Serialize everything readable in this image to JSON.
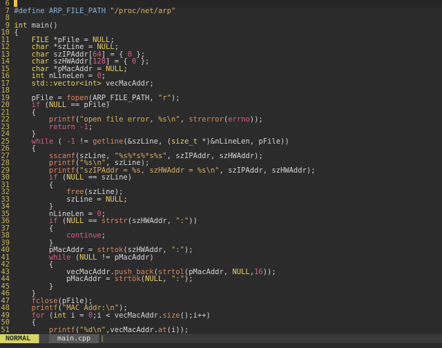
{
  "editor": {
    "lines": [
      {
        "n": "6",
        "current": true,
        "tokens": []
      },
      {
        "n": "7",
        "tokens": [
          [
            "pre",
            "#define ARP_FILE_PATH "
          ],
          [
            "str",
            "\"/proc/net/arp\""
          ]
        ]
      },
      {
        "n": "8",
        "tokens": []
      },
      {
        "n": "9",
        "tokens": [
          [
            "type",
            "int"
          ],
          [
            "plain",
            " main()"
          ]
        ]
      },
      {
        "n": "10",
        "tokens": [
          [
            "plain",
            "{"
          ]
        ]
      },
      {
        "n": "11",
        "tokens": [
          [
            "plain",
            "    "
          ],
          [
            "type",
            "FILE"
          ],
          [
            "plain",
            " *pFile = "
          ],
          [
            "type",
            "NULL"
          ],
          [
            "plain",
            ";"
          ]
        ]
      },
      {
        "n": "12",
        "tokens": [
          [
            "plain",
            "    "
          ],
          [
            "type",
            "char"
          ],
          [
            "plain",
            " *szLine = "
          ],
          [
            "type",
            "NULL"
          ],
          [
            "plain",
            ";"
          ]
        ]
      },
      {
        "n": "13",
        "tokens": [
          [
            "plain",
            "    "
          ],
          [
            "type",
            "char"
          ],
          [
            "plain",
            " szIPAddr["
          ],
          [
            "num",
            "64"
          ],
          [
            "plain",
            "] = { "
          ],
          [
            "num",
            "0"
          ],
          [
            "plain",
            " };"
          ]
        ]
      },
      {
        "n": "14",
        "tokens": [
          [
            "plain",
            "    "
          ],
          [
            "type",
            "char"
          ],
          [
            "plain",
            " szHWAddr["
          ],
          [
            "num",
            "128"
          ],
          [
            "plain",
            "] = { "
          ],
          [
            "num",
            "0"
          ],
          [
            "plain",
            " };"
          ]
        ]
      },
      {
        "n": "15",
        "tokens": [
          [
            "plain",
            "    "
          ],
          [
            "type",
            "char"
          ],
          [
            "plain",
            " *pMacAddr = "
          ],
          [
            "type",
            "NULL"
          ],
          [
            "plain",
            ";"
          ]
        ]
      },
      {
        "n": "16",
        "tokens": [
          [
            "plain",
            "    "
          ],
          [
            "type",
            "int"
          ],
          [
            "plain",
            " nLineLen = "
          ],
          [
            "num",
            "0"
          ],
          [
            "plain",
            ";"
          ]
        ]
      },
      {
        "n": "17",
        "tokens": [
          [
            "plain",
            "    "
          ],
          [
            "type",
            "std::vector<int>"
          ],
          [
            "plain",
            " vecMacAddr;"
          ]
        ]
      },
      {
        "n": "18",
        "tokens": []
      },
      {
        "n": "19",
        "tokens": [
          [
            "plain",
            "    pFile = "
          ],
          [
            "fn",
            "fopen"
          ],
          [
            "plain",
            "(ARP_FILE_PATH, "
          ],
          [
            "str",
            "\"r\""
          ],
          [
            "plain",
            ");"
          ]
        ]
      },
      {
        "n": "20",
        "tokens": [
          [
            "plain",
            "    "
          ],
          [
            "kw",
            "if"
          ],
          [
            "plain",
            " ("
          ],
          [
            "type",
            "NULL"
          ],
          [
            "plain",
            " == pFile)"
          ]
        ]
      },
      {
        "n": "21",
        "tokens": [
          [
            "plain",
            "    {"
          ]
        ]
      },
      {
        "n": "22",
        "tokens": [
          [
            "plain",
            "        "
          ],
          [
            "fn",
            "printf"
          ],
          [
            "plain",
            "("
          ],
          [
            "str",
            "\"open file error, %s\\n\""
          ],
          [
            "plain",
            ", "
          ],
          [
            "fn",
            "strerror"
          ],
          [
            "plain",
            "("
          ],
          [
            "kw",
            "errno"
          ],
          [
            "plain",
            "));"
          ]
        ]
      },
      {
        "n": "23",
        "tokens": [
          [
            "plain",
            "        "
          ],
          [
            "kw",
            "return"
          ],
          [
            "plain",
            " "
          ],
          [
            "num",
            "-1"
          ],
          [
            "plain",
            ";"
          ]
        ]
      },
      {
        "n": "24",
        "tokens": [
          [
            "plain",
            "    }"
          ]
        ]
      },
      {
        "n": "25",
        "tokens": [
          [
            "plain",
            "    "
          ],
          [
            "kw",
            "while"
          ],
          [
            "plain",
            " ( "
          ],
          [
            "num",
            "-1"
          ],
          [
            "plain",
            " != "
          ],
          [
            "fn",
            "getline"
          ],
          [
            "plain",
            "(&szLine, ("
          ],
          [
            "type",
            "size_t"
          ],
          [
            "plain",
            " *)&nLineLen, pFile))"
          ]
        ]
      },
      {
        "n": "26",
        "tokens": [
          [
            "plain",
            "    {"
          ]
        ]
      },
      {
        "n": "27",
        "tokens": [
          [
            "plain",
            "        "
          ],
          [
            "fn",
            "sscanf"
          ],
          [
            "plain",
            "(szLine, "
          ],
          [
            "str",
            "\"%s%*s%*s%s\""
          ],
          [
            "plain",
            ", szIPAddr, szHWAddr);"
          ]
        ]
      },
      {
        "n": "28",
        "tokens": [
          [
            "plain",
            "        "
          ],
          [
            "fn",
            "printf"
          ],
          [
            "plain",
            "("
          ],
          [
            "str",
            "\"%s\\n\""
          ],
          [
            "plain",
            ", szLine);"
          ]
        ]
      },
      {
        "n": "29",
        "tokens": [
          [
            "plain",
            "        "
          ],
          [
            "fn",
            "printf"
          ],
          [
            "plain",
            "("
          ],
          [
            "str",
            "\"szIPAddr = %s, szHWAddr = %s\\n\""
          ],
          [
            "plain",
            ", szIPAddr, szHWAddr);"
          ]
        ]
      },
      {
        "n": "30",
        "tokens": [
          [
            "plain",
            "        "
          ],
          [
            "kw",
            "if"
          ],
          [
            "plain",
            " ("
          ],
          [
            "type",
            "NULL"
          ],
          [
            "plain",
            " == szLine)"
          ]
        ]
      },
      {
        "n": "31",
        "tokens": [
          [
            "plain",
            "        {"
          ]
        ]
      },
      {
        "n": "32",
        "tokens": [
          [
            "plain",
            "            "
          ],
          [
            "fn",
            "free"
          ],
          [
            "plain",
            "(szLine);"
          ]
        ]
      },
      {
        "n": "33",
        "tokens": [
          [
            "plain",
            "            szLine = "
          ],
          [
            "type",
            "NULL"
          ],
          [
            "plain",
            ";"
          ]
        ]
      },
      {
        "n": "34",
        "tokens": [
          [
            "plain",
            "        }"
          ]
        ]
      },
      {
        "n": "35",
        "tokens": [
          [
            "plain",
            "        nLineLen = "
          ],
          [
            "num",
            "0"
          ],
          [
            "plain",
            ";"
          ]
        ]
      },
      {
        "n": "36",
        "tokens": [
          [
            "plain",
            "        "
          ],
          [
            "kw",
            "if"
          ],
          [
            "plain",
            " ("
          ],
          [
            "type",
            "NULL"
          ],
          [
            "plain",
            " == "
          ],
          [
            "fn",
            "strstr"
          ],
          [
            "plain",
            "(szHWAddr, "
          ],
          [
            "str",
            "\":\""
          ],
          [
            "plain",
            "))"
          ]
        ]
      },
      {
        "n": "37",
        "tokens": [
          [
            "plain",
            "        {"
          ]
        ]
      },
      {
        "n": "38",
        "tokens": [
          [
            "plain",
            "            "
          ],
          [
            "kw",
            "continue"
          ],
          [
            "plain",
            ";"
          ]
        ]
      },
      {
        "n": "39",
        "tokens": [
          [
            "plain",
            "        }"
          ]
        ]
      },
      {
        "n": "40",
        "tokens": [
          [
            "plain",
            "        pMacAddr = "
          ],
          [
            "fn",
            "strtok"
          ],
          [
            "plain",
            "(szHWAddr, "
          ],
          [
            "str",
            "\":\""
          ],
          [
            "plain",
            ");"
          ]
        ]
      },
      {
        "n": "41",
        "tokens": [
          [
            "plain",
            "        "
          ],
          [
            "kw",
            "while"
          ],
          [
            "plain",
            " ("
          ],
          [
            "type",
            "NULL"
          ],
          [
            "plain",
            " != pMacAddr)"
          ]
        ]
      },
      {
        "n": "42",
        "tokens": [
          [
            "plain",
            "        {"
          ]
        ]
      },
      {
        "n": "43",
        "tokens": [
          [
            "plain",
            "            vecMacAddr."
          ],
          [
            "fn",
            "push_back"
          ],
          [
            "plain",
            "("
          ],
          [
            "fn",
            "strtol"
          ],
          [
            "plain",
            "(pMacAddr, "
          ],
          [
            "type",
            "NULL"
          ],
          [
            "plain",
            ","
          ],
          [
            "num",
            "16"
          ],
          [
            "plain",
            "));"
          ]
        ]
      },
      {
        "n": "44",
        "tokens": [
          [
            "plain",
            "            pMacAddr = "
          ],
          [
            "fn",
            "strtok"
          ],
          [
            "plain",
            "("
          ],
          [
            "type",
            "NULL"
          ],
          [
            "plain",
            ", "
          ],
          [
            "str",
            "\":\""
          ],
          [
            "plain",
            ");"
          ]
        ]
      },
      {
        "n": "45",
        "tokens": [
          [
            "plain",
            "        }"
          ]
        ]
      },
      {
        "n": "46",
        "tokens": [
          [
            "plain",
            "    }"
          ]
        ]
      },
      {
        "n": "47",
        "tokens": [
          [
            "plain",
            "    "
          ],
          [
            "fn",
            "fclose"
          ],
          [
            "plain",
            "(pFile);"
          ]
        ]
      },
      {
        "n": "48",
        "tokens": [
          [
            "plain",
            "    "
          ],
          [
            "fn",
            "printf"
          ],
          [
            "plain",
            "("
          ],
          [
            "str",
            "\"MAC Addr:\\n\""
          ],
          [
            "plain",
            ");"
          ]
        ]
      },
      {
        "n": "49",
        "tokens": [
          [
            "plain",
            "    "
          ],
          [
            "kw",
            "for"
          ],
          [
            "plain",
            " ("
          ],
          [
            "type",
            "int"
          ],
          [
            "plain",
            " i = "
          ],
          [
            "num",
            "0"
          ],
          [
            "plain",
            ";i < vecMacAddr."
          ],
          [
            "fn",
            "size"
          ],
          [
            "plain",
            "();i++)"
          ]
        ]
      },
      {
        "n": "50",
        "tokens": [
          [
            "plain",
            "    {"
          ]
        ]
      },
      {
        "n": "51",
        "tokens": [
          [
            "plain",
            "        "
          ],
          [
            "fn",
            "printf"
          ],
          [
            "plain",
            "("
          ],
          [
            "str",
            "\"%d\\n\""
          ],
          [
            "plain",
            ",vecMacAddr."
          ],
          [
            "fn",
            "at"
          ],
          [
            "plain",
            "(i));"
          ]
        ]
      }
    ]
  },
  "statusbar": {
    "mode": "NORMAL",
    "filename": "main.cpp",
    "separator": "|"
  },
  "colors": {
    "background": "#2b2b2b",
    "mode_bg": "#d7d75f",
    "line_number": "#c9b458"
  }
}
